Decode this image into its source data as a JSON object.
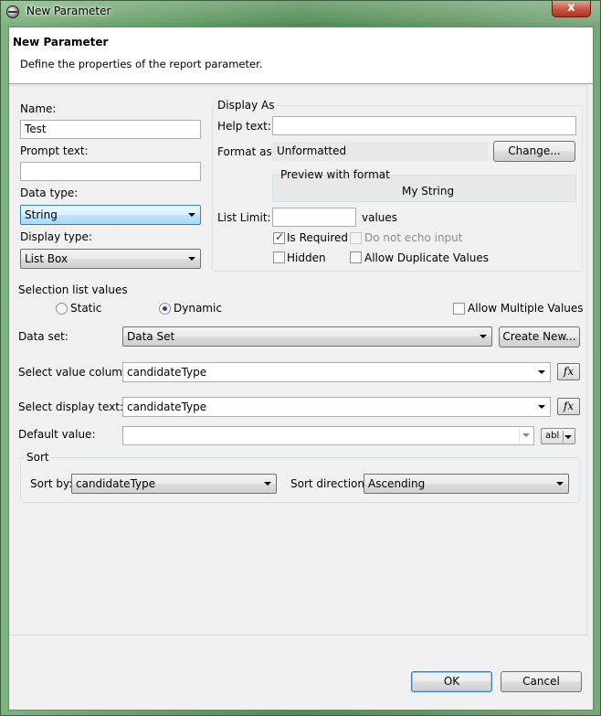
{
  "window": {
    "title": "New Parameter",
    "close_label": "x"
  },
  "header": {
    "title": "New Parameter",
    "description": "Define the properties of the report parameter."
  },
  "left": {
    "name_label": "Name:",
    "name_value": "Test",
    "prompt_label": "Prompt text:",
    "prompt_value": "",
    "datatype_label": "Data type:",
    "datatype_value": "String",
    "displaytype_label": "Display type:",
    "displaytype_value": "List Box"
  },
  "display_as": {
    "group_title": "Display As",
    "help_label": "Help text:",
    "help_value": "",
    "format_label": "Format as:",
    "format_value": "Unformatted",
    "change_button": "Change...",
    "preview_title": "Preview with format",
    "preview_value": "My String",
    "list_limit_label": "List Limit:",
    "list_limit_value": "",
    "list_limit_suffix": "values",
    "is_required": {
      "label": "Is Required",
      "checked": true
    },
    "no_echo": {
      "label": "Do not echo input",
      "checked": false,
      "enabled": false
    },
    "hidden": {
      "label": "Hidden",
      "checked": false
    },
    "allow_duplicates": {
      "label": "Allow Duplicate Values",
      "checked": false
    }
  },
  "selection": {
    "title": "Selection list values",
    "static_label": "Static",
    "dynamic_label": "Dynamic",
    "selected": "Dynamic",
    "allow_multiple_label": "Allow Multiple Values",
    "dataset_label": "Data set:",
    "dataset_value": "Data Set",
    "create_new_button": "Create New...",
    "value_column_label": "Select value column:",
    "value_column_value": "candidateType",
    "display_text_label": "Select display text:",
    "display_text_value": "candidateType",
    "default_label": "Default value:",
    "default_value": "",
    "fx_label": "fx",
    "abl_label": "abl"
  },
  "sort": {
    "title": "Sort",
    "sort_by_label": "Sort by:",
    "sort_by_value": "candidateType",
    "direction_label": "Sort direction:",
    "direction_value": "Ascending"
  },
  "footer": {
    "ok_label": "OK",
    "cancel_label": "Cancel"
  }
}
